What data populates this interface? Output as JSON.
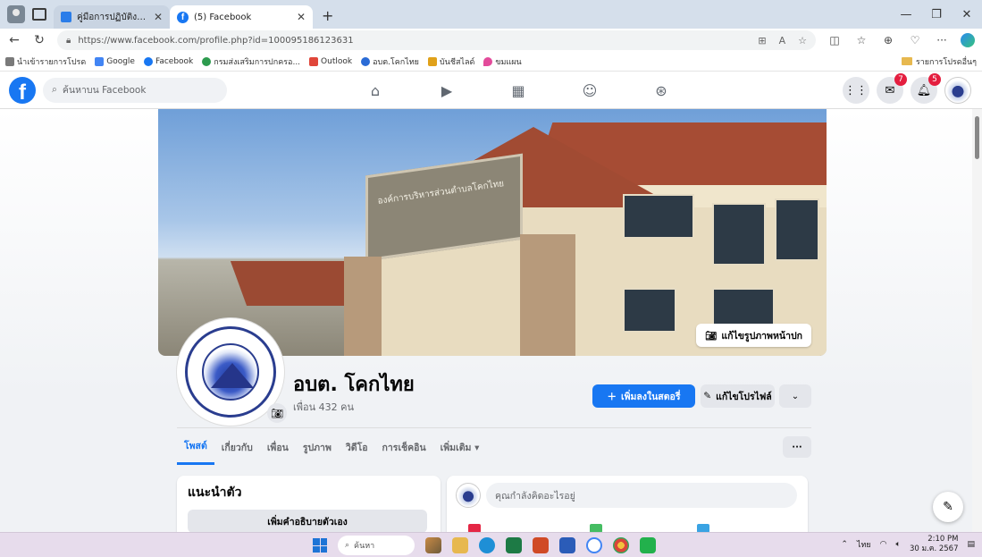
{
  "browser": {
    "tabs": [
      {
        "title": "คู่มือการปฏิบัติงานการจัดการเรื่องร้อง...",
        "active": false
      },
      {
        "title": "(5) Facebook",
        "active": true
      }
    ],
    "new_tab": "+",
    "url": "https://www.facebook.com/profile.php?id=100095186123631",
    "bookmarks": [
      {
        "label": "นำเข้ารายการโปรด",
        "color": "#7a7a7a"
      },
      {
        "label": "Google",
        "color": "#4285f4"
      },
      {
        "label": "Facebook",
        "color": "#1877f2"
      },
      {
        "label": "กรมส่งเสริมการปกครอ...",
        "color": "#2d9b4e"
      },
      {
        "label": "Outlook",
        "color": "#e0463a"
      },
      {
        "label": "อบต.โคกไทย",
        "color": "#2a6bd6"
      },
      {
        "label": "บันชีสไลด์",
        "color": "#e0a11a"
      },
      {
        "label": "ขมแผน",
        "color": "#e34b9b"
      }
    ],
    "other_favorites": "รายการโปรดอื่นๆ"
  },
  "fb": {
    "search_placeholder": "ค้นหาบน Facebook",
    "messenger_badge": "7",
    "notif_badge": "5"
  },
  "profile": {
    "name": "อบต. โคกไทย",
    "friends": "เพื่อน 432 คน",
    "edit_cover": "แก้ไขรูปภาพหน้าปก",
    "add_story": "เพิ่มลงในสตอรี่",
    "edit_profile": "แก้ไขโปรไฟล์",
    "tabs": [
      "โพสต์",
      "เกี่ยวกับ",
      "เพื่อน",
      "รูปภาพ",
      "วิดีโอ",
      "การเช็คอิน",
      "เพิ่มเติม ▾"
    ],
    "tab_more_button": "···"
  },
  "intro": {
    "title": "แนะนำตัว",
    "add_bio": "เพิ่มคำอธิบายตัวเอง"
  },
  "composer": {
    "placeholder": "คุณกำลังคิดอะไรอยู่"
  },
  "taskbar": {
    "search": "ค้นหา",
    "lang": "ไทย",
    "time": "2:10 PM",
    "date": "30 ม.ค. 2567"
  },
  "cover": {
    "sign_text": "องค์การบริหารส่วนตำบลโคกไทย"
  }
}
